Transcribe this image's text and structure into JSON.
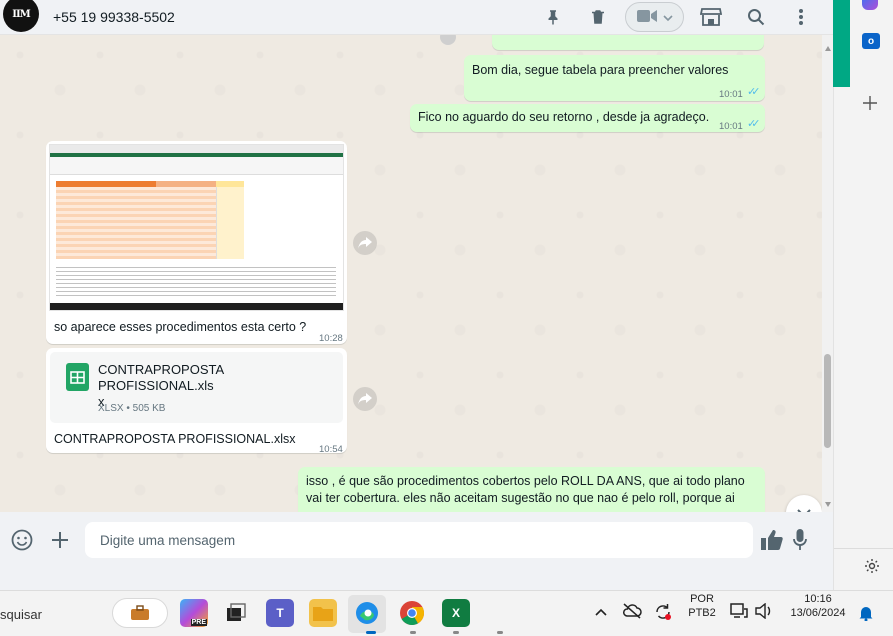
{
  "header": {
    "avatar_text": "IIM",
    "contact": "+55 19 99338-5502"
  },
  "messages": {
    "m1": {
      "text": "Bom dia, segue tabela para preencher valores",
      "time": "10:01"
    },
    "m2": {
      "text": "Fico no aguardo do seu retorno , desde ja agradeço.",
      "time": "10:01"
    },
    "m3": {
      "caption": "so aparece esses procedimentos esta certo ?",
      "time": "10:28"
    },
    "m4": {
      "file_name": "CONTRAPROPOSTA PROFISSIONAL.xls\nx",
      "file_meta": "XLSX • 505 KB",
      "caption": "CONTRAPROPOSTA PROFISSIONAL.xlsx",
      "time": "10:54"
    },
    "m5": {
      "text": "isso , é que são procedimentos cobertos pelo ROLL DA ANS, que ai todo plano vai ter cobertura. eles não aceitam sugestão no que nao é pelo roll, porque ai"
    }
  },
  "composer": {
    "placeholder": "Digite uma mensagem"
  },
  "taskbar": {
    "search_partial": "squisar",
    "lang_top": "POR",
    "lang_bottom": "PTB2",
    "time": "10:16",
    "date": "13/06/2024"
  },
  "colors": {
    "outgoing_bubble": "#d9fdd3",
    "incoming_bubble": "#ffffff",
    "read_ticks": "#53bdeb",
    "accent": "#00a884"
  }
}
